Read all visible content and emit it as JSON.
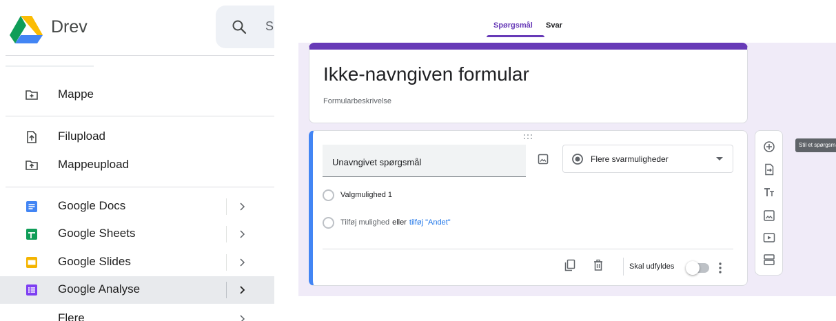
{
  "drive": {
    "title": "Drev",
    "search_text": "S",
    "menu": {
      "folder": "Mappe",
      "file_upload": "Filupload",
      "folder_upload": "Mappeupload",
      "docs": "Google Docs",
      "sheets": "Google Sheets",
      "slides": "Google Slides",
      "forms": "Google Analyse",
      "more": "Flere"
    }
  },
  "forms": {
    "tabs": {
      "questions": "Spørgsmål",
      "answers": "Svar"
    },
    "title": "Ikke-navngiven formular",
    "description": "Formularbeskrivelse",
    "question": {
      "text": "Unavngivet spørgsmål",
      "type": "Flere svarmuligheder",
      "option1": "Valgmulighed 1",
      "add_option": "Tilføj mulighed",
      "or": "eller",
      "add_other": "tilføj \"Andet\"",
      "required": "Skal udfyldes",
      "required_on": false
    },
    "tooltip": "Stil et spørgsmål"
  },
  "colors": {
    "forms_accent": "#673ab7",
    "question_accent": "#4285f4",
    "canvas": "#f0ebf8",
    "link": "#1a73e8"
  }
}
